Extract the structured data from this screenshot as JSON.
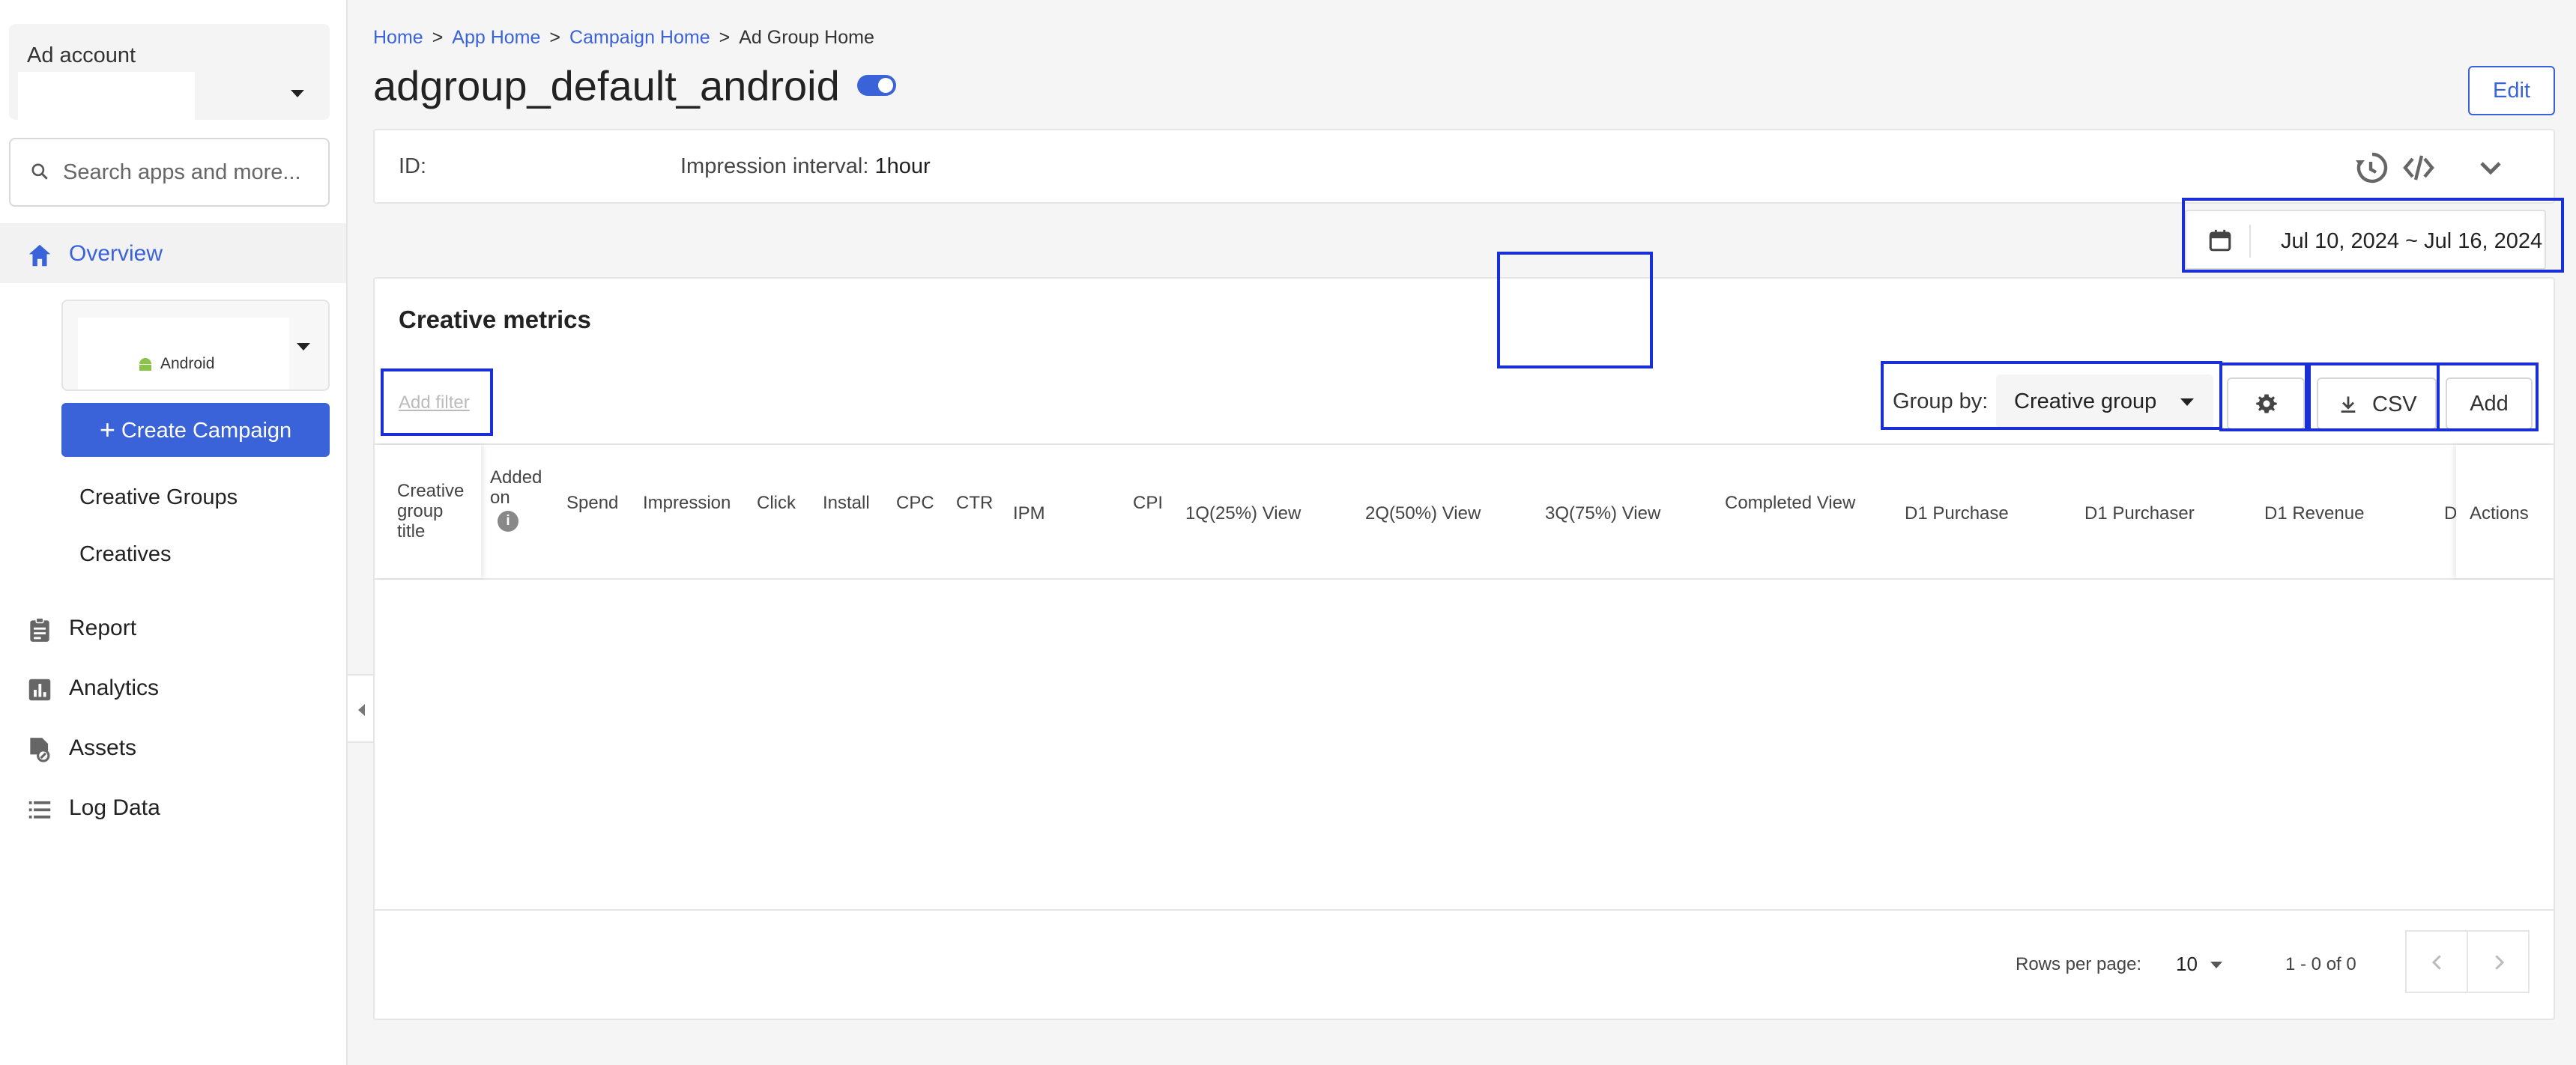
{
  "sidebar": {
    "ad_account_label": "Ad account",
    "search_placeholder": "Search apps and more...",
    "nav": {
      "overview": "Overview",
      "report": "Report",
      "analytics": "Analytics",
      "assets": "Assets",
      "log_data": "Log Data"
    },
    "app_platform": "Android",
    "create_campaign": "Create Campaign",
    "sub_items": {
      "creative_groups": "Creative Groups",
      "creatives": "Creatives"
    }
  },
  "breadcrumb": {
    "home": "Home",
    "app_home": "App Home",
    "campaign_home": "Campaign Home",
    "current": "Ad Group Home",
    "separator": ">"
  },
  "header": {
    "title": "adgroup_default_android",
    "edit_label": "Edit"
  },
  "info_bar": {
    "id_label": "ID:",
    "interval_label": "Impression interval:",
    "interval_value": "1hour"
  },
  "date_range": "Jul 10, 2024 ~ Jul 16, 2024",
  "metrics": {
    "title": "Creative metrics",
    "add_filter": "Add filter",
    "group_by_label": "Group by:",
    "group_by_value": "Creative group",
    "csv_label": "CSV",
    "add_label": "Add",
    "columns": {
      "title_col": [
        "Creative",
        "group",
        "title"
      ],
      "added_on": [
        "Added",
        "on"
      ],
      "info_glyph": "i",
      "spend": "Spend",
      "impression": "Impression",
      "click": "Click",
      "install": "Install",
      "cpc": "CPC",
      "ctr": "CTR",
      "ipm": "IPM",
      "cpi": "CPI",
      "q1": "1Q(25%) View",
      "q2": "2Q(50%) View",
      "q3": "3Q(75%) View",
      "completed": "Completed View",
      "d1_purchase": "D1 Purchase",
      "d1_purchaser": "D1 Purchaser",
      "d1_revenue": "D1 Revenue",
      "truncated": "D",
      "actions": "Actions"
    },
    "pagination": {
      "rows_per_page_label": "Rows per page:",
      "rows_per_page_value": "10",
      "range": "1 - 0 of 0"
    }
  },
  "colors": {
    "accent": "#3b63d9",
    "highlight": "#1a2fd6"
  }
}
